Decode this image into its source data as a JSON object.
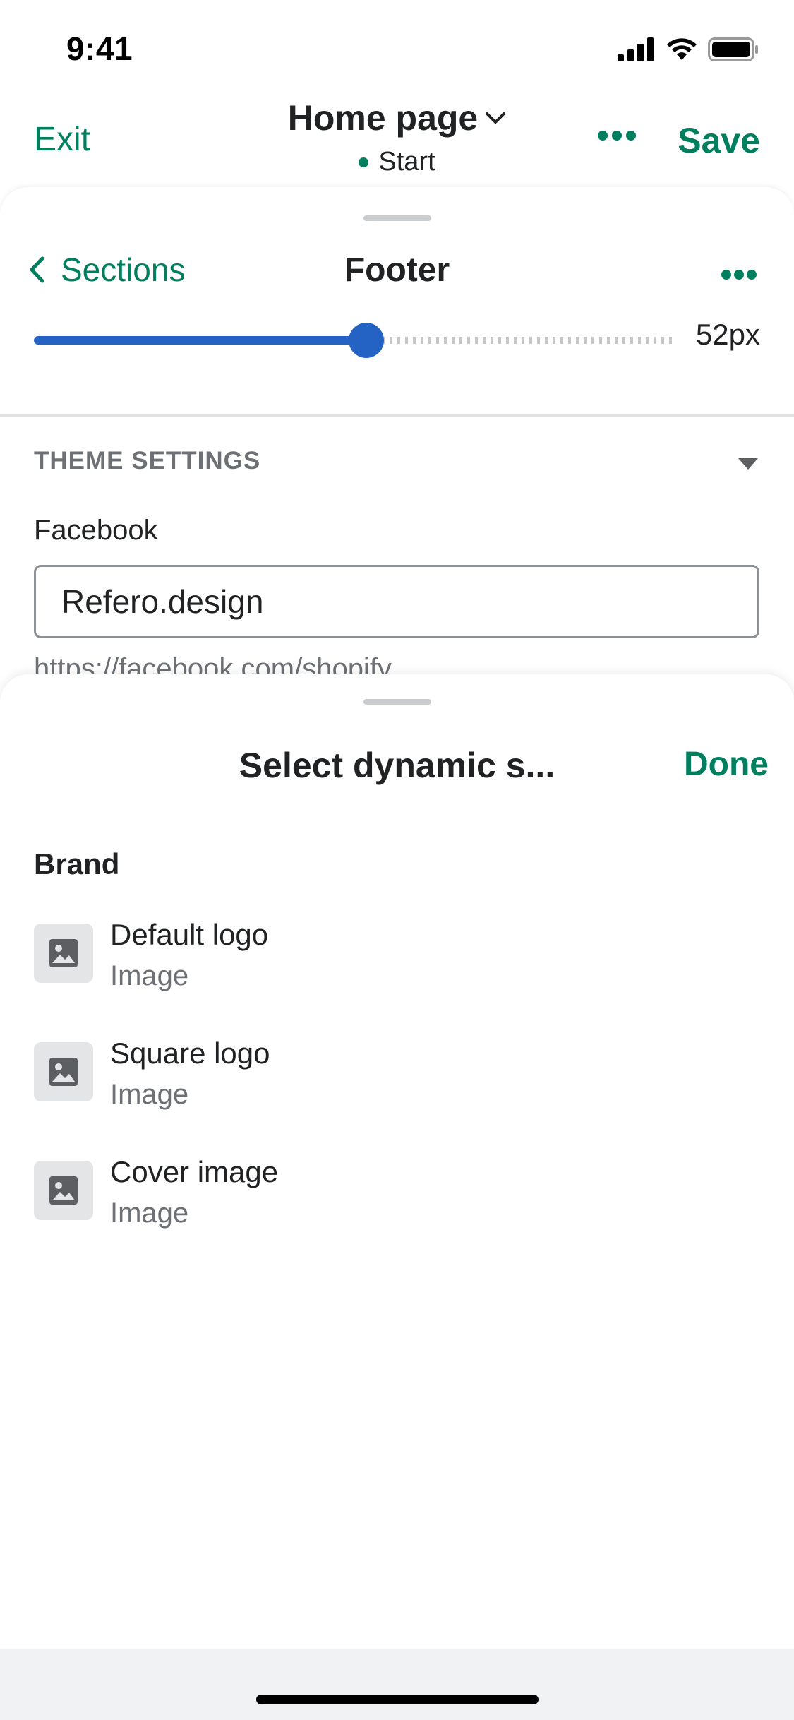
{
  "status_bar": {
    "time": "9:41"
  },
  "header": {
    "exit_label": "Exit",
    "page_title": "Home page",
    "subtitle": "Start",
    "save_label": "Save"
  },
  "panel": {
    "back_label": "Sections",
    "title": "Footer",
    "slider_value": "52px",
    "slider_fill_fraction": 0.52,
    "section_label": "THEME SETTINGS",
    "field_label": "Facebook",
    "field_value": "Refero.design",
    "field_help": "https://facebook.com/shopify"
  },
  "sheet": {
    "title": "Select dynamic s...",
    "done_label": "Done",
    "group_title": "Brand",
    "items": [
      {
        "name": "Default logo",
        "type": "Image"
      },
      {
        "name": "Square logo",
        "type": "Image"
      },
      {
        "name": "Cover image",
        "type": "Image"
      }
    ]
  },
  "colors": {
    "accent": "#007f5f",
    "slider": "#2463c4",
    "text": "#202223",
    "subdued": "#6d7175"
  }
}
